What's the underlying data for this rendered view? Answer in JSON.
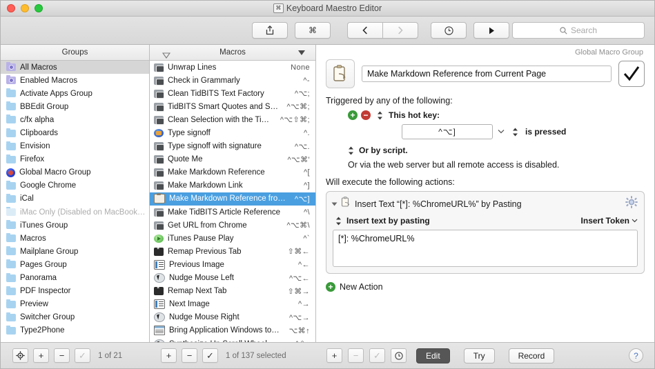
{
  "window": {
    "title": "Keyboard Maestro Editor",
    "title_badge": "⌘"
  },
  "toolbar": {
    "share_label": "share-icon",
    "command_label": "⌘",
    "back_label": "‹",
    "forward_label": "›",
    "clock_label": "clock-icon",
    "play_label": "▶",
    "search_placeholder": "Search",
    "search_value": ""
  },
  "groups_pane": {
    "header": "Groups",
    "items": [
      {
        "label": "All Macros",
        "icon": "purple-gear-folder",
        "selected": true,
        "disabled": false
      },
      {
        "label": "Enabled Macros",
        "icon": "purple-gear-folder",
        "selected": false,
        "disabled": false
      },
      {
        "label": "Activate Apps Group",
        "icon": "blue-folder",
        "selected": false,
        "disabled": false
      },
      {
        "label": "BBEdit Group",
        "icon": "blue-folder",
        "selected": false,
        "disabled": false
      },
      {
        "label": "c/fx alpha",
        "icon": "blue-folder",
        "selected": false,
        "disabled": false
      },
      {
        "label": "Clipboards",
        "icon": "blue-folder",
        "selected": false,
        "disabled": false
      },
      {
        "label": "Envision",
        "icon": "blue-folder",
        "selected": false,
        "disabled": false
      },
      {
        "label": "Firefox",
        "icon": "blue-folder",
        "selected": false,
        "disabled": false
      },
      {
        "label": "Global Macro Group",
        "icon": "globe-icon",
        "selected": false,
        "disabled": false
      },
      {
        "label": "Google Chrome",
        "icon": "blue-folder",
        "selected": false,
        "disabled": false
      },
      {
        "label": "iCal",
        "icon": "blue-folder",
        "selected": false,
        "disabled": false
      },
      {
        "label": "iMac Only (Disabled on MacBook…",
        "icon": "blue-folder",
        "selected": false,
        "disabled": true
      },
      {
        "label": "iTunes Group",
        "icon": "blue-folder",
        "selected": false,
        "disabled": false
      },
      {
        "label": "Macros",
        "icon": "blue-folder",
        "selected": false,
        "disabled": false
      },
      {
        "label": "Mailplane Group",
        "icon": "blue-folder",
        "selected": false,
        "disabled": false
      },
      {
        "label": "Pages Group",
        "icon": "blue-folder",
        "selected": false,
        "disabled": false
      },
      {
        "label": "Panorama",
        "icon": "blue-folder",
        "selected": false,
        "disabled": false
      },
      {
        "label": "PDF Inspector",
        "icon": "blue-folder",
        "selected": false,
        "disabled": false
      },
      {
        "label": "Preview",
        "icon": "blue-folder",
        "selected": false,
        "disabled": false
      },
      {
        "label": "Switcher Group",
        "icon": "blue-folder",
        "selected": false,
        "disabled": false
      },
      {
        "label": "Type2Phone",
        "icon": "blue-folder",
        "selected": false,
        "disabled": false
      }
    ]
  },
  "macros_pane": {
    "header": "Macros",
    "sort_left_icon": "triangle-outline-icon",
    "sort_right_icon": "triangle-filled-icon",
    "items": [
      {
        "name": "Unwrap Lines",
        "key": "None",
        "icon": "macro",
        "selected": false
      },
      {
        "name": "Check in Grammarly",
        "key": "^-",
        "icon": "macro",
        "selected": false
      },
      {
        "name": "Clean TidBITS Text Factory",
        "key": "^⌥;",
        "icon": "macro",
        "selected": false
      },
      {
        "name": "TidBITS Smart Quotes and S…",
        "key": "^⌥⌘;",
        "icon": "macro",
        "selected": false
      },
      {
        "name": "Clean Selection with the Ti…",
        "key": "^⌥⇧⌘;",
        "icon": "macro",
        "selected": false
      },
      {
        "name": "Type signoff",
        "key": "^.",
        "icon": "app",
        "selected": false
      },
      {
        "name": "Type signoff with signature",
        "key": "^⌥.",
        "icon": "macro",
        "selected": false
      },
      {
        "name": "Quote Me",
        "key": "^⌥⌘'",
        "icon": "macro",
        "selected": false
      },
      {
        "name": "Make Markdown Reference",
        "key": "^[",
        "icon": "macro",
        "selected": false
      },
      {
        "name": "Make Markdown Link",
        "key": "^]",
        "icon": "macro",
        "selected": false
      },
      {
        "name": "Make Markdown Reference fro…",
        "key": "^⌥]",
        "icon": "clipboard",
        "selected": true
      },
      {
        "name": "Make TidBITS Article Reference",
        "key": "^\\",
        "icon": "macro",
        "selected": false
      },
      {
        "name": "Get URL from Chrome",
        "key": "^⌥⌘\\",
        "icon": "macro",
        "selected": false
      },
      {
        "name": "iTunes Pause Play",
        "key": "^`",
        "icon": "green",
        "selected": false
      },
      {
        "name": "Remap Previous Tab",
        "key": "⇧⌘←",
        "icon": "dark",
        "selected": false
      },
      {
        "name": "Previous Image",
        "key": "^←",
        "icon": "list",
        "selected": false
      },
      {
        "name": "Nudge Mouse Left",
        "key": "^⌥←",
        "icon": "mouse",
        "selected": false
      },
      {
        "name": "Remap Next Tab",
        "key": "⇧⌘→",
        "icon": "dark",
        "selected": false
      },
      {
        "name": "Next Image",
        "key": "^→",
        "icon": "list",
        "selected": false
      },
      {
        "name": "Nudge Mouse Right",
        "key": "^⌥→",
        "icon": "mouse",
        "selected": false
      },
      {
        "name": "Bring Application Windows to…",
        "key": "⌥⌘↑",
        "icon": "window",
        "selected": false
      },
      {
        "name": "Synthesize Up Scroll Wheel",
        "key": "^⇧↑",
        "icon": "mouse",
        "selected": false
      }
    ]
  },
  "detail": {
    "group_label": "Global Macro Group",
    "macro_name": "Make Markdown Reference from Current Page",
    "enabled_checkmark": "✓",
    "triggered_label": "Triggered by any of the following:",
    "add_button": "+",
    "remove_button": "−",
    "trigger_type": "This hot key:",
    "hotkey_value": "^⌥]",
    "hotkey_condition": "is pressed",
    "or_by_script": "Or by script.",
    "web_server_note": "Or via the web server but all remote access is disabled.",
    "will_execute_label": "Will execute the following actions:",
    "action": {
      "title": "Insert Text “[*]: %ChromeURL%” by Pasting",
      "mode_label": "Insert text by pasting",
      "insert_token_label": "Insert Token",
      "text_value": "[*]: %ChromeURL%"
    },
    "new_action_label": "New Action"
  },
  "bottom": {
    "groups_target_icon": "target-icon",
    "groups_add": "+",
    "groups_remove": "−",
    "groups_check": "✓",
    "groups_count": "1 of 21",
    "macros_add": "+",
    "macros_remove": "−",
    "macros_check": "✓",
    "macros_count": "1 of 137 selected",
    "actions_add": "+",
    "actions_remove": "−",
    "actions_check": "✓",
    "actions_clock": "clock-icon",
    "edit_label": "Edit",
    "try_label": "Try",
    "record_label": "Record",
    "help_label": "?"
  }
}
